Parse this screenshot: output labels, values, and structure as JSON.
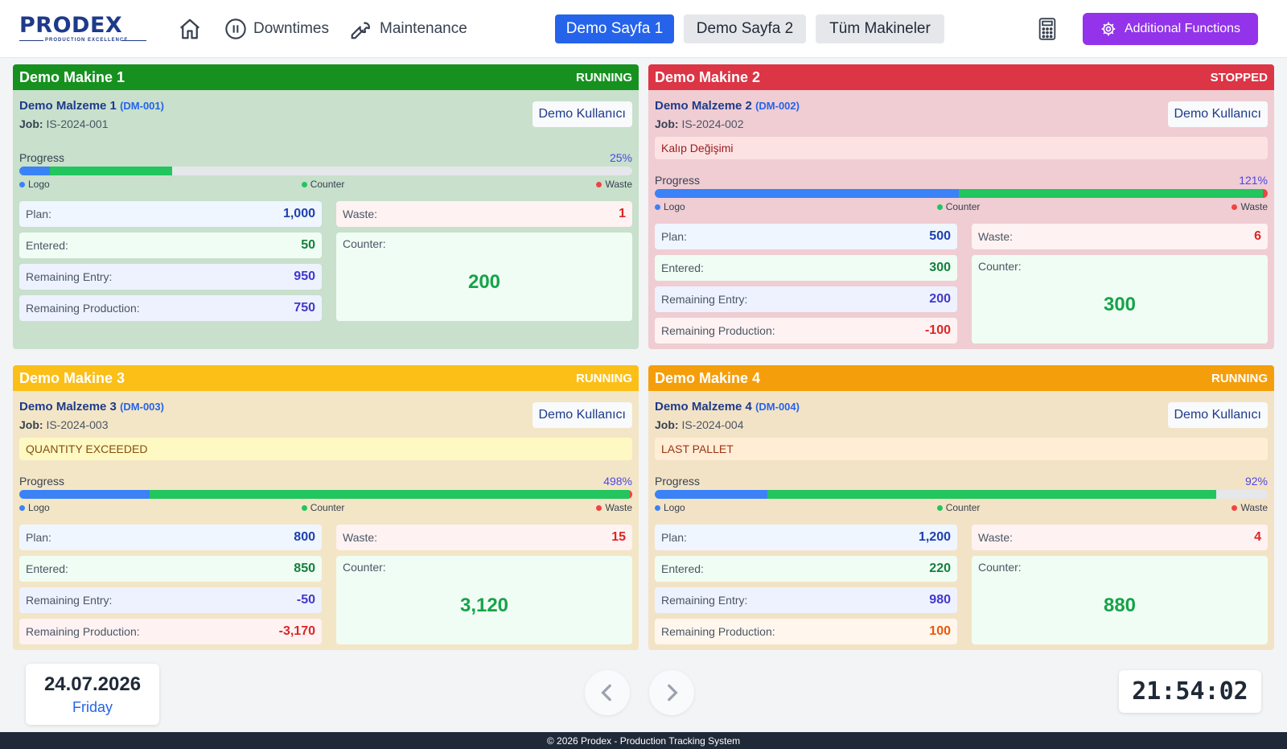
{
  "header": {
    "logo_text": "PRODEX",
    "logo_subtitle": "PRODUCTION EXCELLENCE",
    "nav": {
      "downtimes": "Downtimes",
      "maintenance": "Maintenance"
    },
    "pages": [
      {
        "label": "Demo Sayfa 1",
        "active": true
      },
      {
        "label": "Demo Sayfa 2",
        "active": false
      },
      {
        "label": "Tüm Makineler",
        "active": false
      }
    ],
    "additional_functions": "Additional Functions"
  },
  "labels": {
    "job": "Job:",
    "progress": "Progress",
    "logo": "Logo",
    "counter_legend": "Counter",
    "waste_legend": "Waste",
    "plan": "Plan:",
    "entered": "Entered:",
    "remaining_entry": "Remaining Entry:",
    "remaining_production": "Remaining Production:",
    "waste": "Waste:",
    "counter": "Counter:"
  },
  "machines": [
    {
      "name": "Demo Makine 1",
      "status": "RUNNING",
      "header_color": "#16911f",
      "body_color": "#c8e0cc",
      "material": "Demo Malzeme 1",
      "code": "(DM-001)",
      "job": "IS-2024-001",
      "user": "Demo Kullanıcı",
      "alert": null,
      "progress_pct": "25%",
      "logo_fraction": 0.05,
      "counter_fraction": 0.2,
      "waste_fraction": 0.0,
      "plan": "1,000",
      "entered": "50",
      "remaining_entry": "950",
      "remaining_production": "750",
      "waste": "1",
      "counter": "200",
      "remaining_production_color": "#4338ca",
      "remaining_production_bg": "#eef2ff"
    },
    {
      "name": "Demo Makine 2",
      "status": "STOPPED",
      "header_color": "#dc3545",
      "body_color": "#efcdd3",
      "material": "Demo Malzeme 2",
      "code": "(DM-002)",
      "job": "IS-2024-002",
      "user": "Demo Kullanıcı",
      "alert": "Kalıp Değişimi",
      "alert_bg": "#fde2e4",
      "alert_color": "#991b1b",
      "progress_pct": "121%",
      "logo_fraction": 0.4959,
      "counter_fraction": 0.4959,
      "waste_fraction": 0.0082,
      "plan": "500",
      "entered": "300",
      "remaining_entry": "200",
      "remaining_production": "-100",
      "waste": "6",
      "counter": "300",
      "remaining_production_color": "#dc2626",
      "remaining_production_bg": "#fef2f2"
    },
    {
      "name": "Demo Makine 3",
      "status": "RUNNING",
      "header_color": "#fbbf18",
      "body_color": "#f3e6c6",
      "material": "Demo Malzeme 3",
      "code": "(DM-003)",
      "job": "IS-2024-003",
      "user": "Demo Kullanıcı",
      "alert": "QUANTITY EXCEEDED",
      "alert_bg": "#fef9c3",
      "alert_color": "#854d0e",
      "progress_pct": "498%",
      "logo_fraction": 0.2126,
      "counter_fraction": 0.7834,
      "waste_fraction": 0.004,
      "plan": "800",
      "entered": "850",
      "remaining_entry": "-50",
      "remaining_production": "-3,170",
      "waste": "15",
      "counter": "3,120",
      "remaining_production_color": "#dc2626",
      "remaining_production_bg": "#fef2f2"
    },
    {
      "name": "Demo Makine 4",
      "status": "RUNNING",
      "header_color": "#f59e0b",
      "body_color": "#f3e3c6",
      "material": "Demo Malzeme 4",
      "code": "(DM-004)",
      "job": "IS-2024-004",
      "user": "Demo Kullanıcı",
      "alert": "LAST PALLET",
      "alert_bg": "#ffedd5",
      "alert_color": "#9a3412",
      "progress_pct": "92%",
      "logo_fraction": 0.1833,
      "counter_fraction": 0.7333,
      "waste_fraction": 0.0,
      "plan": "1,200",
      "entered": "220",
      "remaining_entry": "980",
      "remaining_production": "100",
      "waste": "4",
      "counter": "880",
      "remaining_production_color": "#ea580c",
      "remaining_production_bg": "#fff7ed"
    }
  ],
  "footer_bar": {
    "date": "24.07.2026",
    "weekday": "Friday",
    "time": "21:54:02",
    "copyright": "© 2026 Prodex - Production Tracking System"
  }
}
